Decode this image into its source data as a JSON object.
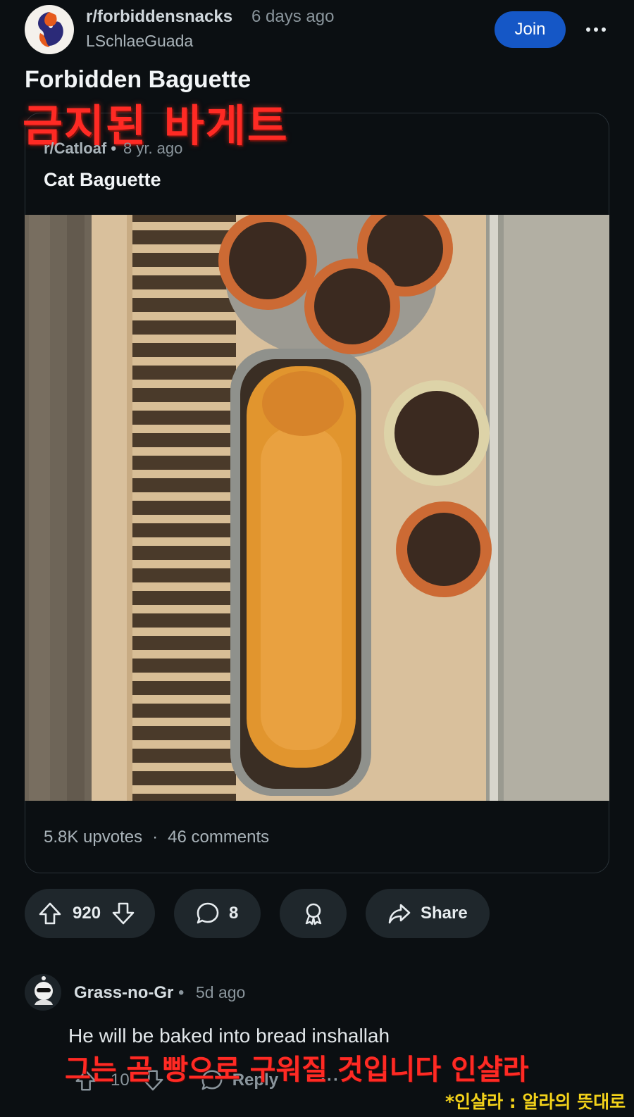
{
  "header": {
    "subreddit": "r/forbiddensnacks",
    "time": "6 days ago",
    "author": "LSchlaeGuada",
    "join_label": "Join",
    "more_icon": "more-horizontal-icon"
  },
  "post": {
    "title": "Forbidden Baguette",
    "title_translation": "금지된 바게트"
  },
  "crosspost": {
    "subreddit": "r/Catloaf",
    "time_sep": "•",
    "time": "8 yr. ago",
    "title": "Cat Baguette",
    "upvotes": "5.8K upvotes",
    "stats_sep": "·",
    "comments": "46 comments"
  },
  "actions": {
    "score": "920",
    "comment_count": "8",
    "share_label": "Share"
  },
  "comment": {
    "author": "Grass-no-Gr",
    "time_sep": "•",
    "time": "5d ago",
    "body": "He will be baked into bread inshallah",
    "body_translation": "그는 곧 빵으로 구워질 것입니다 인샬라",
    "score": "10",
    "reply_label": "Reply",
    "more": "···"
  },
  "note": "*인샬라 : 알라의 뜻대로",
  "colors": {
    "background": "#0b0f12",
    "join": "#1557c6",
    "translation_red": "#ff2a24",
    "note_yellow": "#f3d21a"
  }
}
